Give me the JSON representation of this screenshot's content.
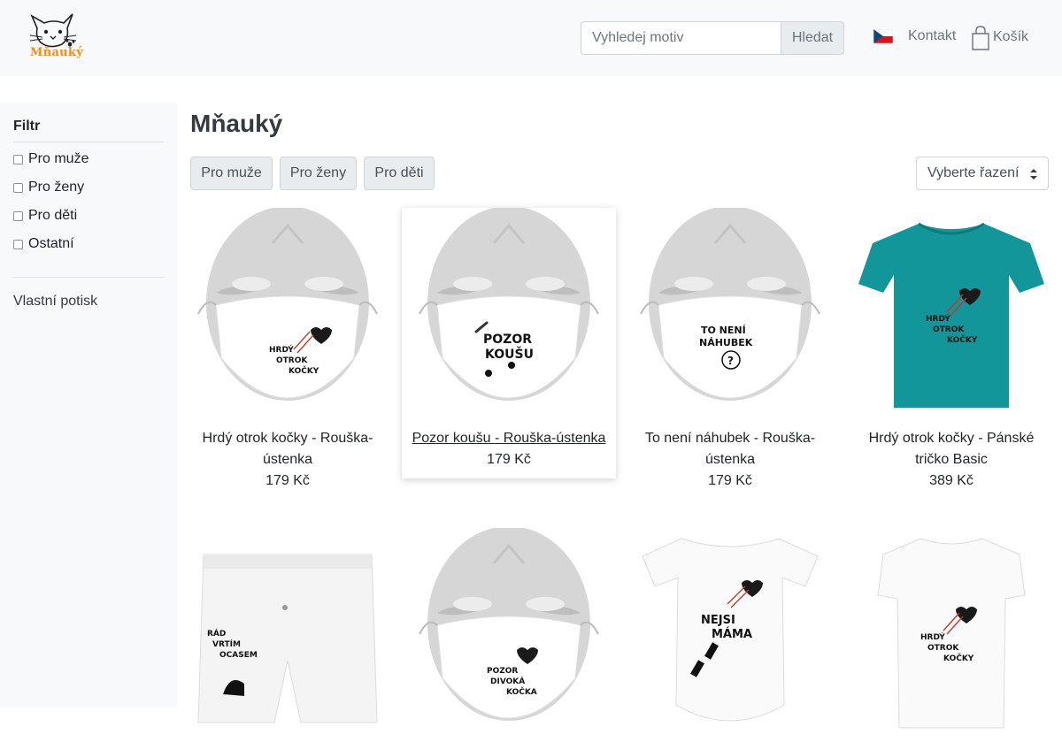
{
  "header": {
    "logo_text": "Mňauký",
    "search_placeholder": "Vyhledej motiv",
    "search_button": "Hledat",
    "language_flag": "czech-flag-icon",
    "contact_link": "Kontakt",
    "cart_label": "Košík"
  },
  "sidebar": {
    "filter_title": "Filtr",
    "filters": [
      "Pro muže",
      "Pro ženy",
      "Pro děti",
      "Ostatní"
    ],
    "custom_print_link": "Vlastní potisk"
  },
  "main": {
    "title": "Mňauký",
    "category_buttons": [
      "Pro muže",
      "Pro ženy",
      "Pro děti"
    ],
    "sort_select": "Vyberte řazení"
  },
  "products": [
    {
      "name": "Hrdý otrok kočky - Rouška-ústenka",
      "price": "179 Kč",
      "image": "face-mask",
      "print": "HRDÝ OTROK KOČKY"
    },
    {
      "name": "Pozor koušu - Rouška-ústenka",
      "price": "179 Kč",
      "image": "face-mask",
      "print": "POZOR KOUŠU"
    },
    {
      "name": "To není náhubek - Rouška-ústenka",
      "price": "179 Kč",
      "image": "face-mask",
      "print": "TO NENÍ NÁHUBEK"
    },
    {
      "name": "Hrdý otrok kočky - Pánské tričko Basic",
      "price": "389 Kč",
      "image": "tshirt",
      "print": "HRDÝ OTROK KOČKY"
    },
    {
      "name": "",
      "price": "",
      "image": "boxer-shorts",
      "print": "RÁD VRTÍM OCASEM"
    },
    {
      "name": "",
      "price": "",
      "image": "face-mask",
      "print": "POZOR DIVOKÁ KOČKA"
    },
    {
      "name": "",
      "price": "",
      "image": "baby-bodysuit",
      "print": "NEJSI MÁMA"
    },
    {
      "name": "",
      "price": "",
      "image": "womens-tshirt",
      "print": "HRDÝ OTROK KOČKY"
    }
  ],
  "colors": {
    "logo_orange": "#f08c1a",
    "tshirt_teal": "#12969a",
    "heart": "#1a1a1a",
    "claw": "#c0392b"
  }
}
